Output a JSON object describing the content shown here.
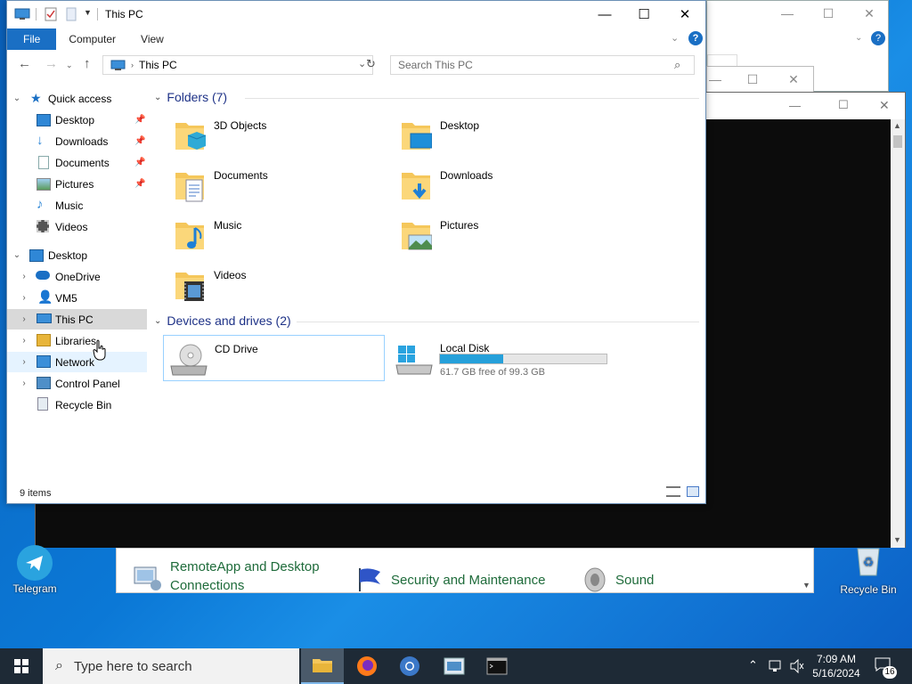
{
  "explorer": {
    "title": "This PC",
    "ribbon_tabs": [
      "File",
      "Computer",
      "View"
    ],
    "address": "This PC",
    "search_placeholder": "Search This PC",
    "status": "9 items",
    "nav": {
      "quick_access": "Quick access",
      "qa_items": [
        "Desktop",
        "Downloads",
        "Documents",
        "Pictures",
        "Music",
        "Videos"
      ],
      "root": "Desktop",
      "root_items": [
        "OneDrive",
        "VM5",
        "This PC",
        "Libraries",
        "Network",
        "Control Panel",
        "Recycle Bin"
      ]
    },
    "folders_header": "Folders (7)",
    "folders": [
      "3D Objects",
      "Desktop",
      "Documents",
      "Downloads",
      "Music",
      "Pictures",
      "Videos"
    ],
    "devices_header": "Devices and drives (2)",
    "drives": [
      {
        "name": "CD Drive"
      },
      {
        "name": "Local Disk",
        "free": "61.7 GB free of 99.3 GB",
        "used_fraction": 0.38
      }
    ]
  },
  "control_panel": {
    "items": [
      "RemoteApp and Desktop Connections",
      "Security and Maintenance",
      "Sound"
    ]
  },
  "desktop_icons": [
    "Telegram",
    "Recycle Bin"
  ],
  "taskbar": {
    "search_placeholder": "Type here to search",
    "time": "7:09 AM",
    "date": "5/16/2024",
    "notif_count": "16"
  },
  "colors": {
    "accent": "#1a6fc4",
    "drive_fill": "#26a0da",
    "taskbar": "#1e2a36"
  }
}
